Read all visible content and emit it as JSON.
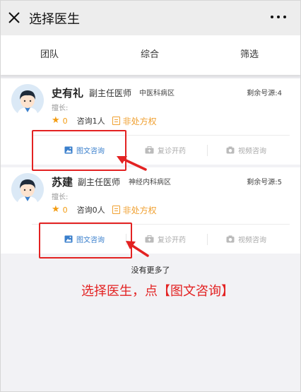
{
  "header": {
    "title": "选择医生",
    "close_icon": "close-icon",
    "more_icon": "more-icon"
  },
  "tabs": [
    {
      "label": "团队"
    },
    {
      "label": "综合"
    },
    {
      "label": "筛选"
    }
  ],
  "doctors": [
    {
      "name": "史有礼",
      "title": "副主任医师",
      "department": "中医科病区",
      "remaining": "剩余号源:4",
      "specialty": "擅长:",
      "rating": "0",
      "consult_count": "咨询1人",
      "prescription": "非处方权",
      "actions": {
        "text": "图文咨询",
        "prescribe": "复诊开药",
        "video": "视频咨询"
      }
    },
    {
      "name": "苏建",
      "title": "副主任医师",
      "department": "神经内科病区",
      "remaining": "剩余号源:5",
      "specialty": "擅长:",
      "rating": "0",
      "consult_count": "咨询0人",
      "prescription": "非处方权",
      "actions": {
        "text": "图文咨询",
        "prescribe": "复诊开药",
        "video": "视频咨询"
      }
    }
  ],
  "list_end": "没有更多了",
  "annotation": "选择医生，点【图文咨询】",
  "colors": {
    "accent_blue": "#3a7fcc",
    "star_orange": "#f39c12",
    "prescription_orange": "#f0a030",
    "annotation_red": "#e32222",
    "disabled_gray": "#aaaaaa"
  }
}
